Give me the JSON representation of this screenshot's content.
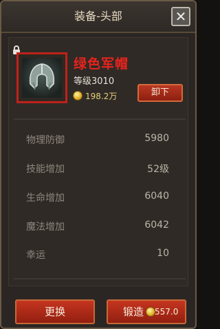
{
  "window": {
    "title": "装备-头部",
    "close_label": "✕"
  },
  "item": {
    "name": "绿色军帽",
    "level_text": "等级3010",
    "price": "198.2万",
    "unequip_label": "卸下"
  },
  "stats": [
    {
      "label": "物理防御",
      "value": "5980"
    },
    {
      "label": "技能增加",
      "value": "52级"
    },
    {
      "label": "生命增加",
      "value": "6040"
    },
    {
      "label": "魔法增加",
      "value": "6042"
    },
    {
      "label": "幸运",
      "value": "10"
    }
  ],
  "actions": {
    "replace_label": "更换",
    "forge_label": "锻造",
    "forge_cost": "557.0万"
  },
  "colors": {
    "accent_red": "#e8231e",
    "gold": "#e6cf7a"
  },
  "icons": [
    "lock-icon",
    "close-icon",
    "coin-icon",
    "helmet-icon"
  ]
}
